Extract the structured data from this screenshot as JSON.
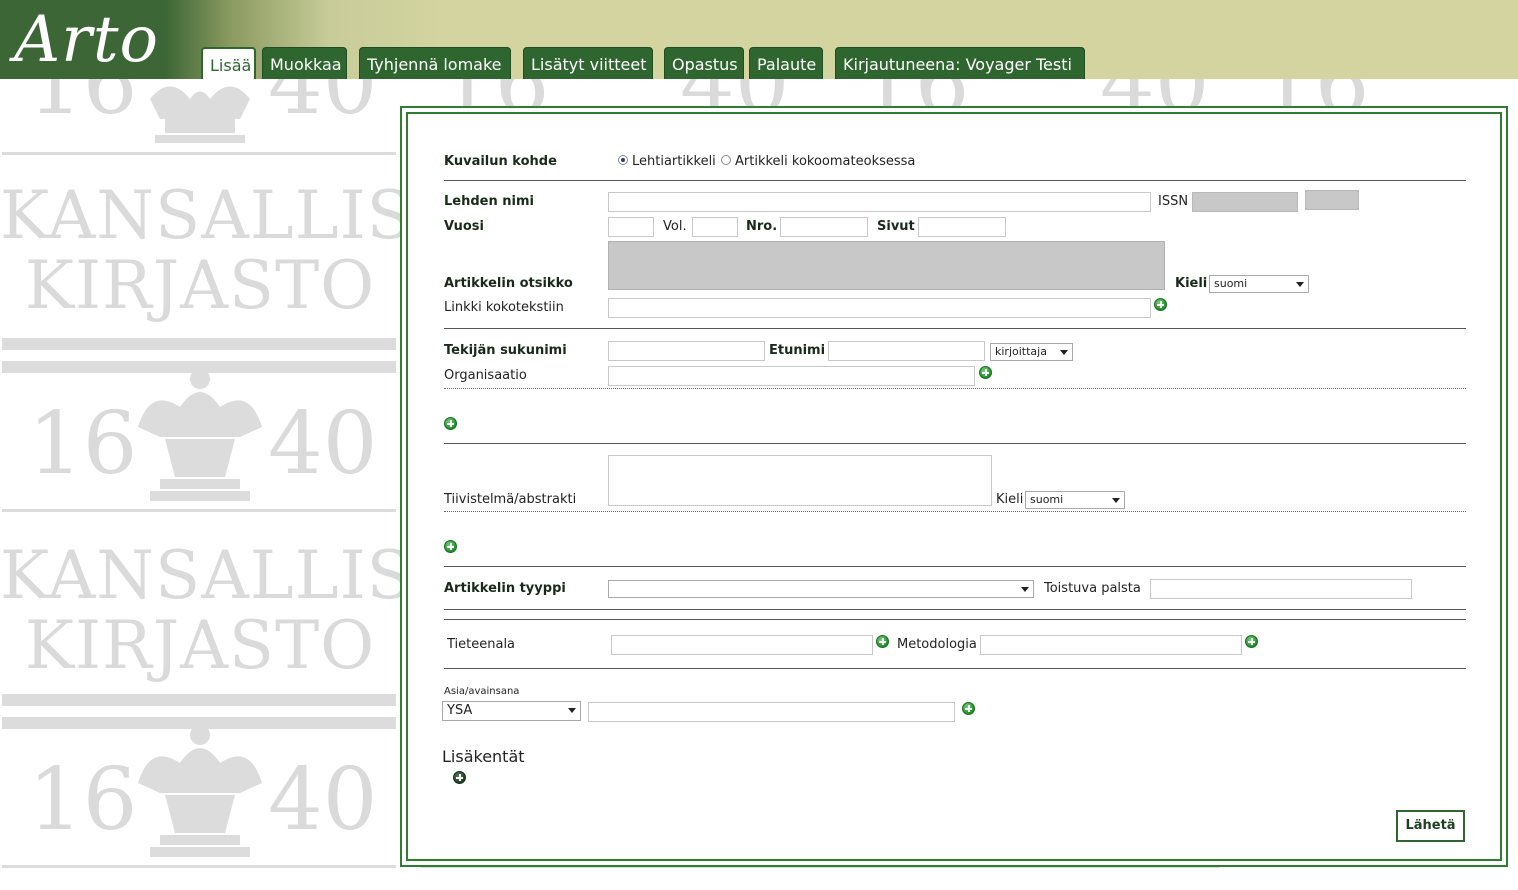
{
  "app": {
    "logo": "Arto"
  },
  "tabs": [
    {
      "label": "Lisää",
      "active": true
    },
    {
      "label": "Muokkaa",
      "active": false
    },
    {
      "label": "Tyhjennä lomake",
      "active": false
    },
    {
      "label": "Lisätyt viitteet",
      "active": false
    },
    {
      "label": "Opastus",
      "active": false
    },
    {
      "label": "Palaute",
      "active": false
    },
    {
      "label": "Kirjautuneena: Voyager Testi",
      "active": false
    }
  ],
  "watermark": {
    "word1": "KANSALLIS",
    "word2": "KIRJASTO",
    "year_left": "16",
    "year_right": "40"
  },
  "form": {
    "kuvailun_kohde": {
      "label": "Kuvailun kohde",
      "options": [
        "Lehtiartikkeli",
        "Artikkeli kokoomateoksessa"
      ],
      "selected": "Lehtiartikkeli"
    },
    "lehden_nimi": {
      "label": "Lehden nimi",
      "value": ""
    },
    "issn": {
      "label": "ISSN",
      "value": ""
    },
    "vuosi": {
      "label": "Vuosi",
      "value": ""
    },
    "vol": {
      "label": "Vol.",
      "value": ""
    },
    "nro": {
      "label": "Nro.",
      "value": ""
    },
    "sivut": {
      "label": "Sivut",
      "value": ""
    },
    "artikkelin_otsikko": {
      "label": "Artikkelin otsikko",
      "value": ""
    },
    "kieli": {
      "label": "Kieli",
      "value": "suomi"
    },
    "linkki": {
      "label": "Linkki kokotekstiin",
      "value": ""
    },
    "tekijan_sukunimi": {
      "label": "Tekijän sukunimi",
      "value": ""
    },
    "etunimi": {
      "label": "Etunimi",
      "value": ""
    },
    "rooli": {
      "value": "kirjoittaja"
    },
    "organisaatio": {
      "label": "Organisaatio",
      "value": ""
    },
    "tiivistelma": {
      "label": "Tiivistelmä/abstrakti",
      "value": ""
    },
    "tiivistelma_kieli": {
      "label": "Kieli",
      "value": "suomi"
    },
    "artikkelin_tyyppi": {
      "label": "Artikkelin tyyppi",
      "value": ""
    },
    "toistuva_palsta": {
      "label": "Toistuva palsta",
      "value": ""
    },
    "tieteenala": {
      "label": "Tieteenala",
      "value": ""
    },
    "metodologia": {
      "label": "Metodologia",
      "value": ""
    },
    "asia": {
      "label": "Asia/avainsana",
      "vocabulary": "YSA",
      "value": ""
    },
    "lisakentat": {
      "label": "Lisäkentät"
    },
    "submit": {
      "label": "Lähetä"
    }
  },
  "colors": {
    "header_bg": "#d3d4a0",
    "brand_green": "#2f6630",
    "panel_border": "#2f7d31",
    "watermark": "#dadada",
    "plus_icon": "#1f8f2a"
  },
  "icons": [
    "plus-circle-icon",
    "dropdown-arrow-icon",
    "textarea-resize-icon",
    "radio-icon"
  ]
}
